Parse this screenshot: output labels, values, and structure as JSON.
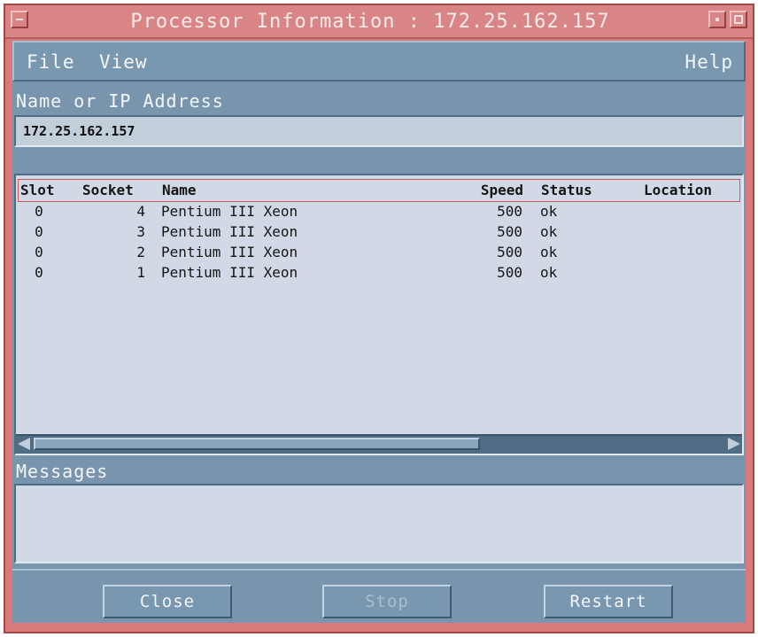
{
  "window": {
    "title": "Processor Information : 172.25.162.157"
  },
  "menu": {
    "file": "File",
    "view": "View",
    "help": "Help"
  },
  "name_field": {
    "label": "Name or IP Address",
    "value": "172.25.162.157"
  },
  "table": {
    "columns": [
      "Slot",
      "Socket",
      "Name",
      "Speed",
      "Status",
      "Location"
    ],
    "rows": [
      {
        "slot": "0",
        "socket": "4",
        "name": "Pentium III Xeon",
        "speed": "500",
        "status": "ok",
        "location": ""
      },
      {
        "slot": "0",
        "socket": "3",
        "name": "Pentium III Xeon",
        "speed": "500",
        "status": "ok",
        "location": ""
      },
      {
        "slot": "0",
        "socket": "2",
        "name": "Pentium III Xeon",
        "speed": "500",
        "status": "ok",
        "location": ""
      },
      {
        "slot": "0",
        "socket": "1",
        "name": "Pentium III Xeon",
        "speed": "500",
        "status": "ok",
        "location": ""
      }
    ]
  },
  "messages": {
    "label": "Messages",
    "text": ""
  },
  "buttons": {
    "close": "Close",
    "stop": "Stop",
    "restart": "Restart"
  },
  "colors": {
    "title_bar": "#d98585",
    "client_bg": "#7895ad",
    "list_bg": "#d1d9e6",
    "header_outline": "#cc5a5a"
  },
  "icons": {
    "window_menu": "window-menu-icon",
    "minimize": "minimize-icon",
    "maximize": "maximize-icon",
    "scroll_left": "scroll-left-arrow-icon",
    "scroll_right": "scroll-right-arrow-icon"
  }
}
